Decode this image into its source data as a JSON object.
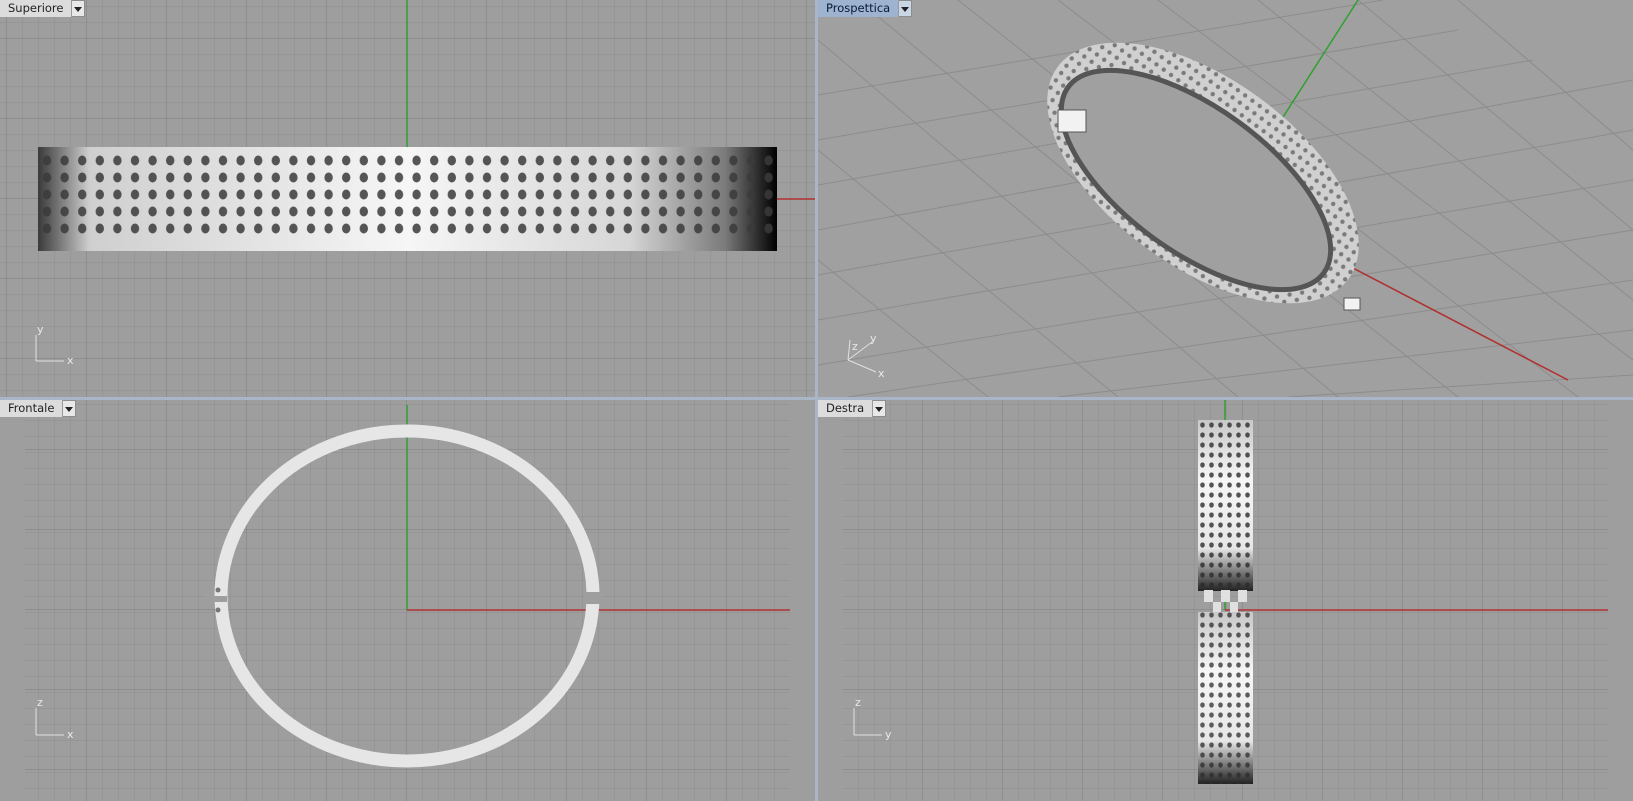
{
  "viewports": {
    "top": {
      "title": "Superiore",
      "axis_h": "x",
      "axis_v": "y",
      "active": false
    },
    "perspective": {
      "title": "Prospettica",
      "axis_a": "x",
      "axis_b": "y",
      "axis_c": "z",
      "active": true
    },
    "front": {
      "title": "Frontale",
      "axis_h": "x",
      "axis_v": "z",
      "active": false
    },
    "right": {
      "title": "Destra",
      "axis_h": "y",
      "axis_v": "z",
      "active": false
    }
  },
  "colors": {
    "grid_bg": "#9e9e9e",
    "grid_minor": "#8f8f8f",
    "grid_major": "#7d7d7d",
    "x_axis": "#b03030",
    "y_axis": "#2ea02e",
    "object": "#e8e8e8",
    "active_label": "#9db3cf",
    "separator": "#a9b6c8"
  },
  "icons": {
    "menu": "dropdown-arrow-icon"
  }
}
